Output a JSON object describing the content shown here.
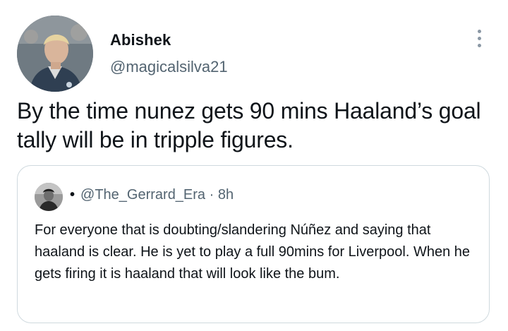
{
  "tweet": {
    "author_name": "Abishek",
    "author_handle": "@magicalsilva21",
    "text": "By the time nunez gets 90 mins Haaland’s goal tally will be in tripple figures.",
    "avatar_icon": "user-avatar-photo",
    "more_icon": "more-vertical-icon"
  },
  "quoted": {
    "bullet": "•",
    "handle": "@The_Gerrard_Era",
    "separator": "·",
    "time": "8h",
    "text": "For everyone that is doubting/slandering Núñez and saying that haaland is clear. He is yet to play a full 90mins for Liverpool. When he gets firing it is haaland that will look like the bum.",
    "avatar_icon": "user-avatar-photo"
  },
  "colors": {
    "text_primary": "#0f1419",
    "text_secondary": "#536471",
    "border": "#cfd9de"
  }
}
